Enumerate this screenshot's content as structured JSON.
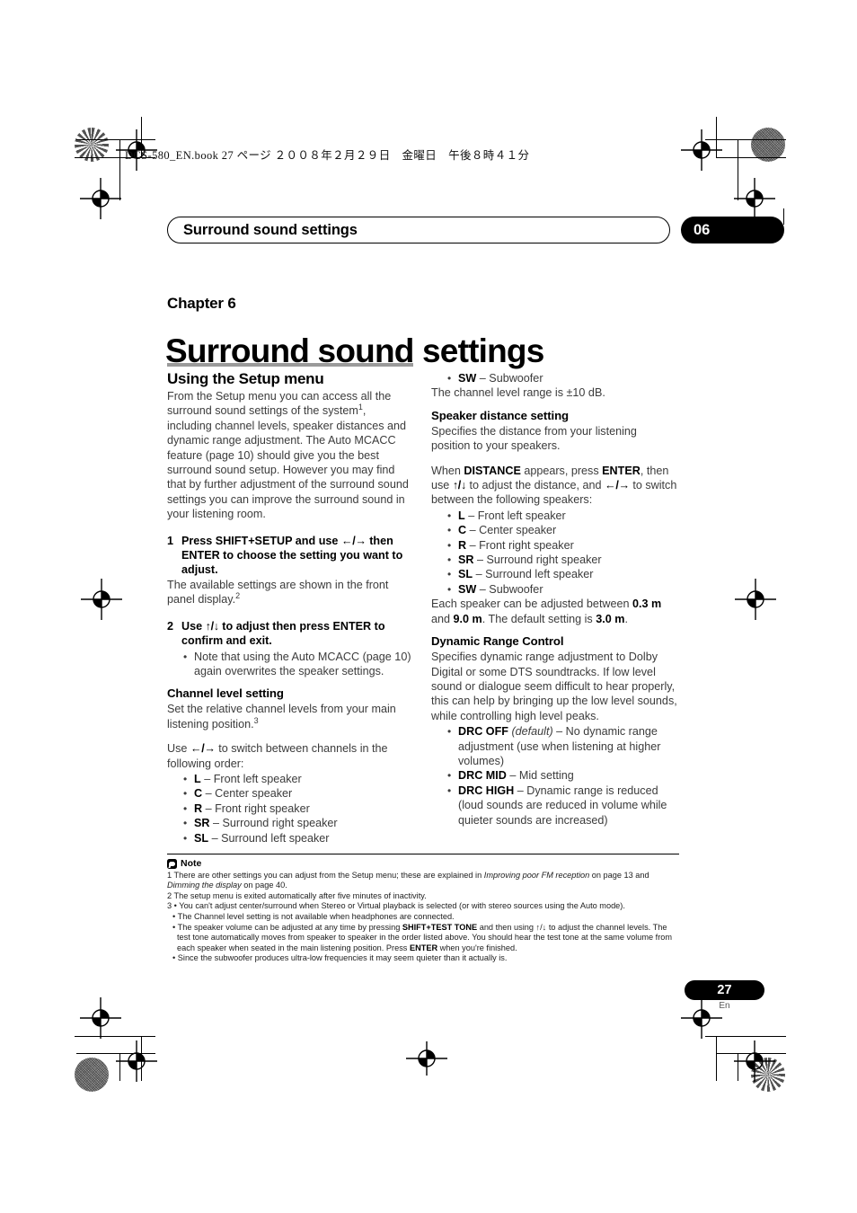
{
  "print_header": "DCS-580_EN.book  27 ページ  ２００８年２月２９日　金曜日　午後８時４１分",
  "chapter_bar": {
    "running_title": "Surround sound settings",
    "chapter_number": "06"
  },
  "title_block": {
    "chapter_label": "Chapter 6",
    "page_title": "Surround sound settings"
  },
  "left_column": {
    "section_heading": "Using the Setup menu",
    "intro_part1": "From the Setup menu you can access all the surround sound settings of the system",
    "intro_footnote": "1",
    "intro_part2": ", including channel levels, speaker distances and dynamic range adjustment. The Auto MCACC feature (page 10) should give you the best surround sound setup. However you may find that by further adjustment of the surround sound settings you can improve the surround sound in your listening room.",
    "step1": {
      "number": "1",
      "text_a": "Press SHIFT+SETUP and use ",
      "arrows": "←/→",
      "text_b": " then ENTER to choose the setting you want to adjust.",
      "body_a": "The available settings are shown in the front panel display.",
      "body_footnote": "2"
    },
    "step2": {
      "number": "2",
      "text_a": "Use ",
      "arrows": "↑/↓",
      "text_b": " to adjust then press ENTER to confirm and exit.",
      "bullets": [
        "Note that using the Auto MCACC (page 10) again overwrites the speaker settings."
      ]
    },
    "channel_level": {
      "heading": "Channel level setting",
      "body_a": "Set the relative channel levels from your main listening position.",
      "body_footnote": "3",
      "body_b_pre": "Use ",
      "body_b_arrows": "←/→",
      "body_b_post": " to switch between channels in the following order:",
      "speakers": [
        {
          "code": "L",
          "desc": " – Front left speaker"
        },
        {
          "code": "C",
          "desc": " – Center speaker"
        },
        {
          "code": "R",
          "desc": " – Front right speaker"
        },
        {
          "code": "SR",
          "desc": " – Surround right speaker"
        },
        {
          "code": "SL",
          "desc": " – Surround left speaker"
        }
      ]
    }
  },
  "right_column": {
    "channel_level_cont": {
      "speakers": [
        {
          "code": "SW",
          "desc": " – Subwoofer"
        }
      ],
      "range_text": "The channel level range is ±10 dB."
    },
    "speaker_distance": {
      "heading": "Speaker distance setting",
      "body_a": "Specifies the distance from your listening position to your speakers.",
      "instr_1": "When ",
      "instr_distance": "DISTANCE",
      "instr_2": " appears, press ",
      "instr_enter": "ENTER",
      "instr_3": ", then use ",
      "instr_ud": "↑/↓",
      "instr_4": " to adjust the distance, and ",
      "instr_lr": "←/→",
      "instr_5": " to switch between the following speakers:",
      "speakers": [
        {
          "code": "L",
          "desc": " – Front left speaker"
        },
        {
          "code": "C",
          "desc": " – Center speaker"
        },
        {
          "code": "R",
          "desc": " – Front right speaker"
        },
        {
          "code": "SR",
          "desc": " – Surround right speaker"
        },
        {
          "code": "SL",
          "desc": " – Surround left speaker"
        },
        {
          "code": "SW",
          "desc": " – Subwoofer"
        }
      ],
      "range_pre": "Each speaker can be adjusted between ",
      "range_min": "0.3 m",
      "range_mid": " and ",
      "range_max": "9.0 m",
      "range_post": ". The default setting is ",
      "range_default": "3.0 m",
      "range_end": "."
    },
    "dynamic_range": {
      "heading": "Dynamic Range Control",
      "body": "Specifies dynamic range adjustment to Dolby Digital or some DTS soundtracks. If low level sound or dialogue seem difficult to hear properly, this can help by bringing up the low level sounds, while controlling high level peaks.",
      "options": [
        {
          "code": "DRC OFF",
          "italic": " (default)",
          "desc": " – No dynamic range adjustment (use when listening at higher volumes)"
        },
        {
          "code": "DRC MID",
          "italic": "",
          "desc": " – Mid setting"
        },
        {
          "code": "DRC HIGH",
          "italic": "",
          "desc": " – Dynamic range is reduced (loud sounds are reduced in volume while quieter sounds are increased)"
        }
      ]
    }
  },
  "notes": {
    "title": "Note",
    "items": [
      {
        "num": "1",
        "pre": " There are other settings you can adjust from the Setup menu; these are explained in ",
        "italic1": "Improving poor FM reception",
        "mid": " on page 13 and ",
        "italic2": "Dimming the display",
        "post": " on page 40."
      },
      {
        "num": "2",
        "pre": " The setup menu is exited automatically after five minutes of inactivity.",
        "italic1": "",
        "mid": "",
        "italic2": "",
        "post": ""
      }
    ],
    "item3_num": "3",
    "item3_bullets": [
      {
        "pre": "You can't adjust center/surround when Stereo or Virtual playback is selected (or with stereo sources using the Auto mode).",
        "bold1": "",
        "mid": "",
        "bold2": "",
        "post": ""
      },
      {
        "pre": "The Channel level setting is not available when headphones are connected.",
        "bold1": "",
        "mid": "",
        "bold2": "",
        "post": ""
      },
      {
        "pre": "The speaker volume can be adjusted at any time by pressing ",
        "bold1": "SHIFT+TEST TONE",
        "mid": " and then using ↑/↓ to adjust the channel levels. The test tone automatically moves from speaker to speaker in the order listed above. You should hear the test tone at the same volume from each speaker when seated in the main listening position. Press ",
        "bold2": "ENTER",
        "post": " when you're finished."
      },
      {
        "pre": "Since the subwoofer produces ultra-low frequencies it may seem quieter than it actually is.",
        "bold1": "",
        "mid": "",
        "bold2": "",
        "post": ""
      }
    ]
  },
  "page_footer": {
    "page_number": "27",
    "language": "En"
  }
}
